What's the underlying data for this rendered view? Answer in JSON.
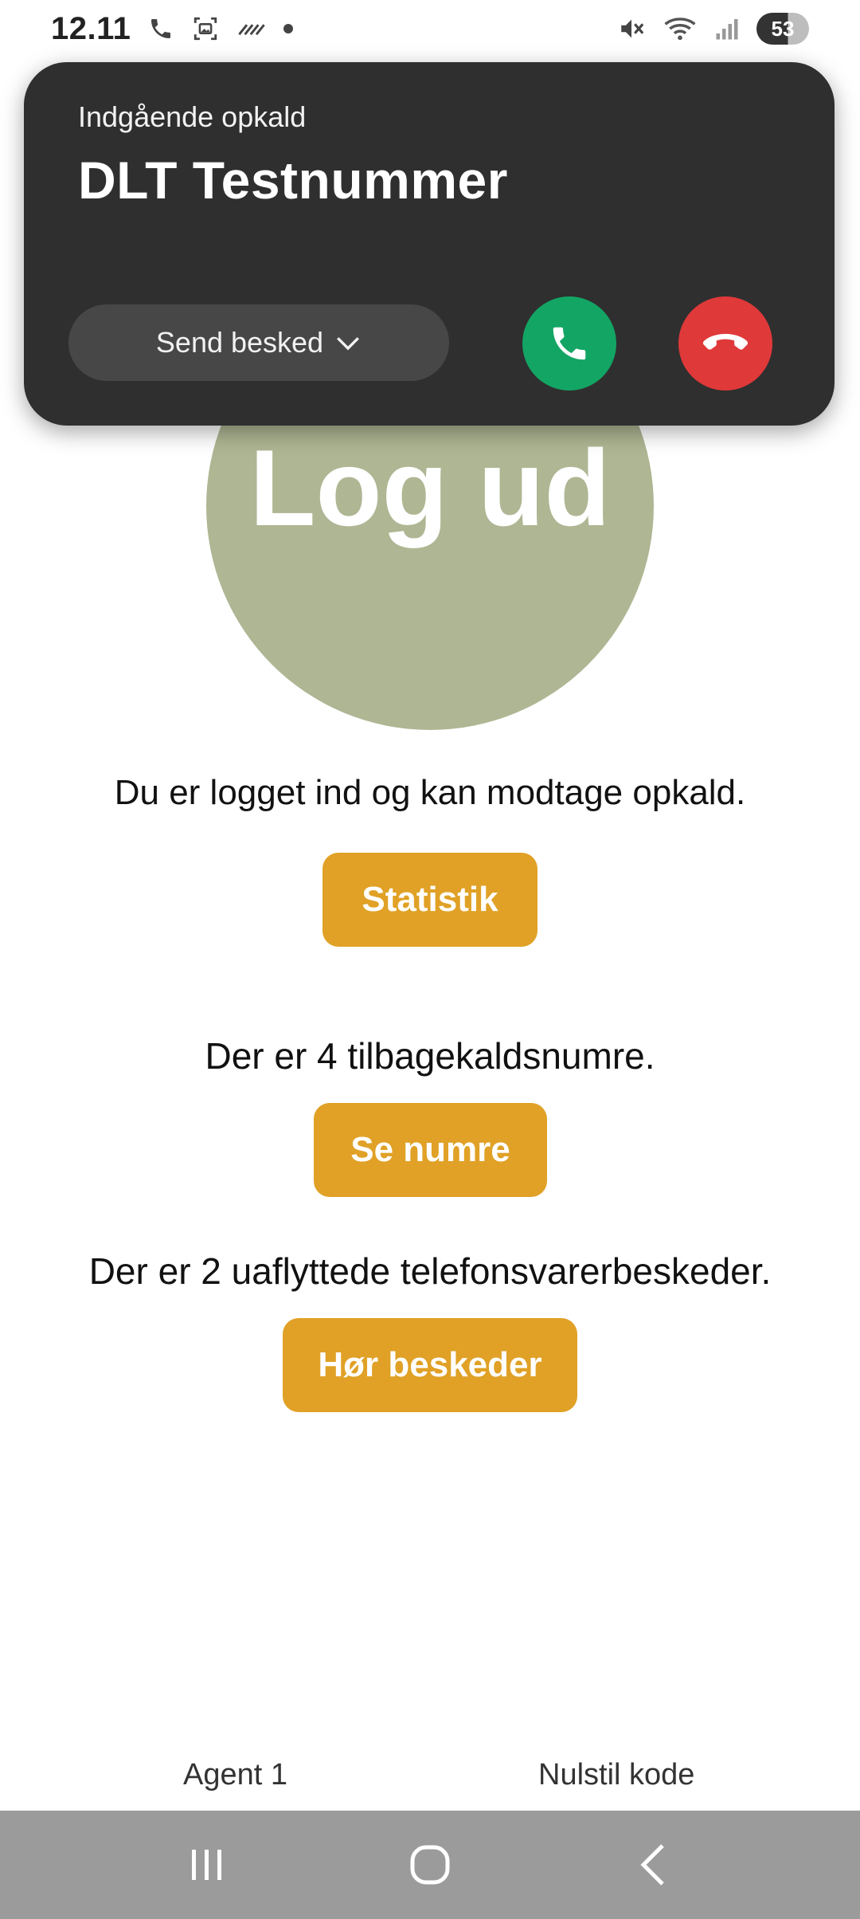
{
  "status_bar": {
    "time": "12.11",
    "battery": "53"
  },
  "incoming_call": {
    "label": "Indgående opkald",
    "caller": "DLT Testnummer",
    "send_message_label": "Send besked"
  },
  "main": {
    "logout_label": "Log ud",
    "logged_in_text": "Du er logget ind og kan modtage opkald.",
    "statistics_button": "Statistik",
    "callback_text": "Der er 4 tilbagekaldsnumre.",
    "see_numbers_button": "Se numre",
    "voicemail_text": "Der er 2 uaflyttede telefonsvarerbeskeder.",
    "listen_messages_button": "Hør beskeder"
  },
  "footer": {
    "agent_label": "Agent 1",
    "reset_code_label": "Nulstil kode"
  },
  "colors": {
    "call_card_bg": "#2f2f2f",
    "accept": "#13a564",
    "decline": "#e0393a",
    "logout_circle": "#aeb693",
    "action_button": "#e0a126",
    "nav_bar": "#9b9b9b"
  }
}
